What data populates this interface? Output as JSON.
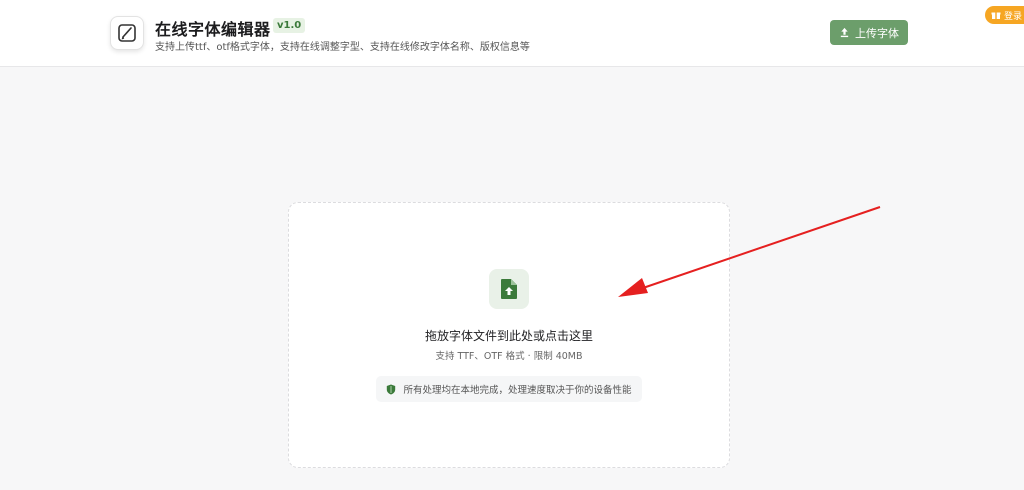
{
  "header": {
    "title": "在线字体编辑器",
    "version": "v1.0",
    "subtitle": "支持上传ttf、otf格式字体，支持在线调整字型、支持在线修改字体名称、版权信息等",
    "upload_label": "上传字体",
    "login_label": "登录"
  },
  "dropzone": {
    "title": "拖放字体文件到此处或点击这里",
    "subtitle": "支持 TTF、OTF 格式 · 限制 40MB",
    "privacy_note": "所有处理均在本地完成，处理速度取决于你的设备性能"
  },
  "colors": {
    "accent": "#6c9e6b",
    "accent_dark": "#3b7a3a",
    "annotation": "#e52020",
    "login_bg": "#f6a623"
  },
  "icons": [
    "pen-icon",
    "upload-icon",
    "gift-icon",
    "file-upload-icon",
    "shield-icon",
    "annotation-arrow"
  ]
}
